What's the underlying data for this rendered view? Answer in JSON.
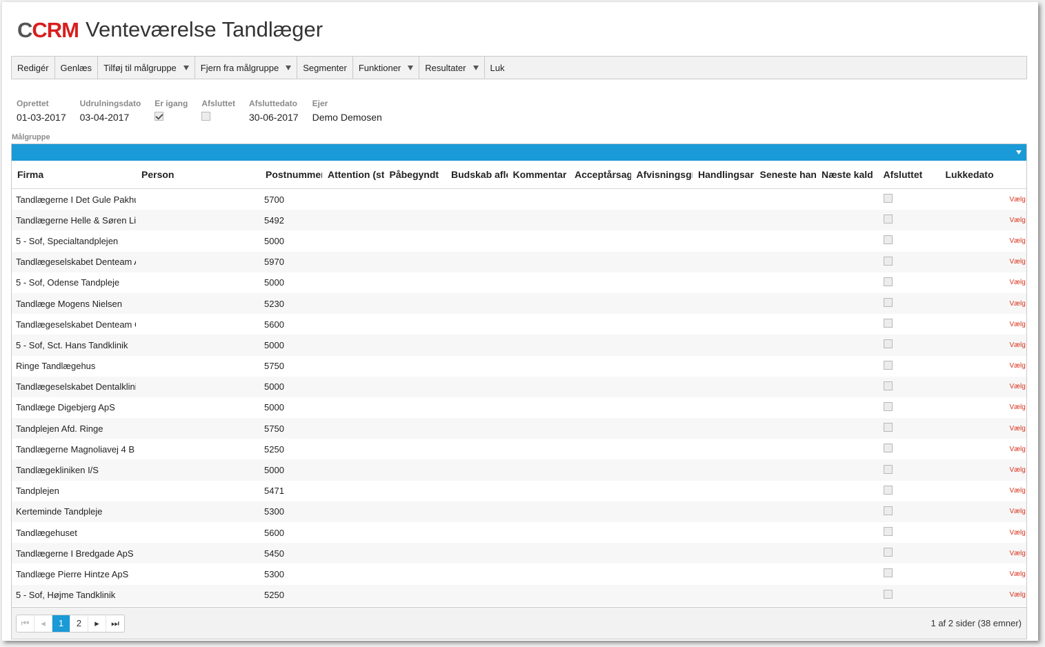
{
  "header": {
    "logo_c": "C",
    "logo_crm": "CRM",
    "title": "Venteværelse Tandlæger"
  },
  "toolbar": {
    "items": [
      {
        "label": "Redigér",
        "dropdown": false
      },
      {
        "label": "Genlæs",
        "dropdown": false
      },
      {
        "label": "Tilføj til målgruppe",
        "dropdown": true
      },
      {
        "label": "Fjern fra målgruppe",
        "dropdown": true
      },
      {
        "label": "Segmenter",
        "dropdown": false
      },
      {
        "label": "Funktioner",
        "dropdown": true
      },
      {
        "label": "Resultater",
        "dropdown": true
      },
      {
        "label": "Luk",
        "dropdown": false
      }
    ]
  },
  "meta": {
    "oprettet_label": "Oprettet",
    "oprettet_value": "01-03-2017",
    "udrulning_label": "Udrulningsdato",
    "udrulning_value": "03-04-2017",
    "erigang_label": "Er igang",
    "erigang_checked": true,
    "afsluttet_label": "Afsluttet",
    "afsluttet_checked": false,
    "afsluttedato_label": "Afsluttedato",
    "afsluttedato_value": "30-06-2017",
    "ejer_label": "Ejer",
    "ejer_value": "Demo Demosen"
  },
  "group_label": "Målgruppe",
  "columns": [
    "Firma",
    "Person",
    "Postnummer",
    "Attention (st",
    "Påbegyndt",
    "Budskab afle",
    "Kommentar",
    "Acceptårsag",
    "Afvisningsgr",
    "Handlingsar",
    "Seneste han",
    "Næste kald",
    "Afsluttet",
    "Lukkedato"
  ],
  "choose_label": "Vælg",
  "rows": [
    {
      "firma": "Tandlægerne I Det Gule Pakhus",
      "post": "5700"
    },
    {
      "firma": "Tandlægerne Helle & Søren Li",
      "post": "5492"
    },
    {
      "firma": "5 - Sof, Specialtandplejen",
      "post": "5000"
    },
    {
      "firma": "Tandlægeselskabet Denteam A",
      "post": "5970"
    },
    {
      "firma": "5 - Sof, Odense Tandpleje",
      "post": "5000"
    },
    {
      "firma": "Tandlæge Mogens Nielsen",
      "post": "5230"
    },
    {
      "firma": "Tandlægeselskabet Denteam O",
      "post": "5600"
    },
    {
      "firma": "5 - Sof, Sct. Hans Tandklinik",
      "post": "5000"
    },
    {
      "firma": "Ringe Tandlægehus",
      "post": "5750"
    },
    {
      "firma": "Tandlægeselskabet Dentalklinik",
      "post": "5000"
    },
    {
      "firma": "Tandlæge Digebjerg ApS",
      "post": "5000"
    },
    {
      "firma": "Tandplejen Afd. Ringe",
      "post": "5750"
    },
    {
      "firma": "Tandlægerne Magnoliavej 4 B",
      "post": "5250"
    },
    {
      "firma": "Tandlægekliniken I/S",
      "post": "5000"
    },
    {
      "firma": "Tandplejen",
      "post": "5471"
    },
    {
      "firma": "Kerteminde Tandpleje",
      "post": "5300"
    },
    {
      "firma": "Tandlægehuset",
      "post": "5600"
    },
    {
      "firma": "Tandlægerne I Bredgade ApS",
      "post": "5450"
    },
    {
      "firma": "Tandlæge Pierre Hintze ApS",
      "post": "5300"
    },
    {
      "firma": "5 - Sof, Højme Tandklinik",
      "post": "5250"
    }
  ],
  "pager": {
    "pages": [
      "1",
      "2"
    ],
    "current": "1",
    "info": "1 af 2 sider (38 emner)"
  },
  "colors": {
    "accent": "#1a9ad6",
    "logo_red": "#d81e1e",
    "choose_red": "#d9341c"
  }
}
